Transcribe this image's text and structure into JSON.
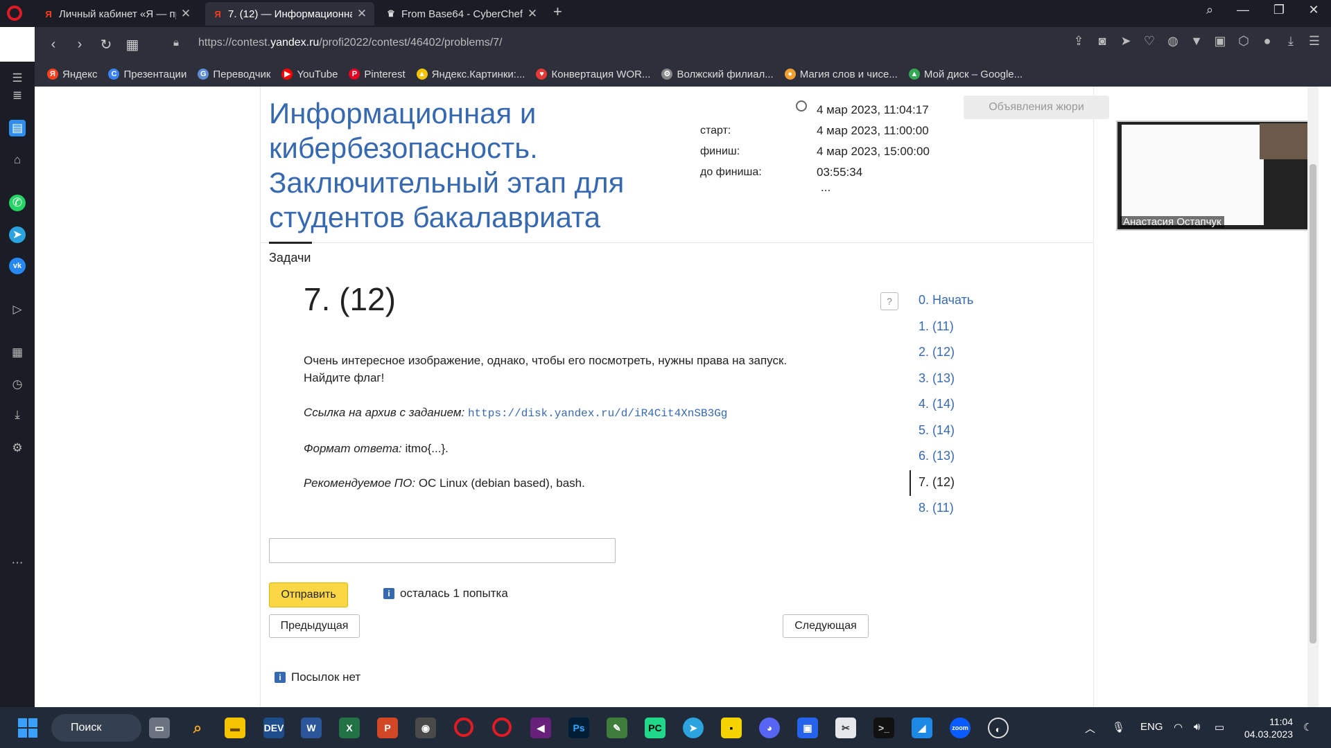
{
  "browser": {
    "tabs": [
      {
        "title": "Личный кабинет «Я — пр",
        "icon": "yandex-icon",
        "active": false
      },
      {
        "title": "7. (12) — Информационна",
        "icon": "yandex-icon",
        "active": true
      },
      {
        "title": "From Base64 - CyberChef",
        "icon": "chef-hat-icon",
        "active": false
      }
    ],
    "url_prefix": "https://contest.",
    "url_domain": "yandex.ru",
    "url_path": "/profi2022/contest/46402/problems/7/",
    "bookmarks": [
      {
        "label": "Яндекс",
        "color": "#fc3f1d",
        "glyph": "Я"
      },
      {
        "label": "Презентации",
        "color": "#3b82f6",
        "glyph": "C"
      },
      {
        "label": "Переводчик",
        "color": "#5f8dd3",
        "glyph": "G"
      },
      {
        "label": "YouTube",
        "color": "#ff0000",
        "glyph": "▶"
      },
      {
        "label": "Pinterest",
        "color": "#e60023",
        "glyph": "P"
      },
      {
        "label": "Яндекс.Картинки:...",
        "color": "#f5c400",
        "glyph": "▲"
      },
      {
        "label": "Конвертация WOR...",
        "color": "#e53935",
        "glyph": "♥"
      },
      {
        "label": "Волжский филиал...",
        "color": "#888888",
        "glyph": "⚙"
      },
      {
        "label": "Магия слов и чисе...",
        "color": "#f0a030",
        "glyph": "●"
      },
      {
        "label": "Мой диск – Google...",
        "color": "#34a853",
        "glyph": "▲"
      }
    ]
  },
  "contest": {
    "title": "Информационная и кибербезопасность. Заключительный этап для студентов бакалавриата",
    "now_value": "4 мар 2023, 11:04:17",
    "start_label": "старт:",
    "start_value": "4 мар 2023, 11:00:00",
    "finish_label": "финиш:",
    "finish_value": "4 мар 2023, 15:00:00",
    "remaining_label": "до финиша:",
    "remaining_value": "03:55:34",
    "ellipsis": "...",
    "jury_button": "Объявления жюри",
    "tasks_tab": "Задачи"
  },
  "problem": {
    "title": "7. (12)",
    "description_line1": "Очень интересное изображение, однако, чтобы его посмотреть, нужны права на запуск.",
    "description_line2": "Найдите флаг!",
    "link_label": "Ссылка на архив с заданием:",
    "link_url": "https://disk.yandex.ru/d/iR4Cit4XnSB3Gg",
    "format_label": "Формат ответа:",
    "format_value": "itmo{...}.",
    "software_label": "Рекомендуемое ПО:",
    "software_value": "ОС Linux (debian based), bash.",
    "help": "?",
    "answer_value": "",
    "submit_button": "Отправить",
    "attempts_text": "осталась 1 попытка",
    "prev_button": "Предыдущая",
    "next_button": "Следующая",
    "no_submissions": "Посылок нет"
  },
  "problem_list": [
    {
      "label": "0. Начать",
      "current": false
    },
    {
      "label": "1. (11)",
      "current": false
    },
    {
      "label": "2. (12)",
      "current": false
    },
    {
      "label": "3. (13)",
      "current": false
    },
    {
      "label": "4. (14)",
      "current": false
    },
    {
      "label": "5. (14)",
      "current": false
    },
    {
      "label": "6. (13)",
      "current": false
    },
    {
      "label": "7. (12)",
      "current": true
    },
    {
      "label": "8. (11)",
      "current": false
    }
  ],
  "video": {
    "participant": "Анастасия Остапчук"
  },
  "taskbar": {
    "search_label": "Поиск",
    "language": "ENG",
    "time": "11:04",
    "date": "04.03.2023"
  },
  "colors": {
    "link": "#3769b0",
    "submit": "#fcd745",
    "taskbar": "#202a38"
  }
}
